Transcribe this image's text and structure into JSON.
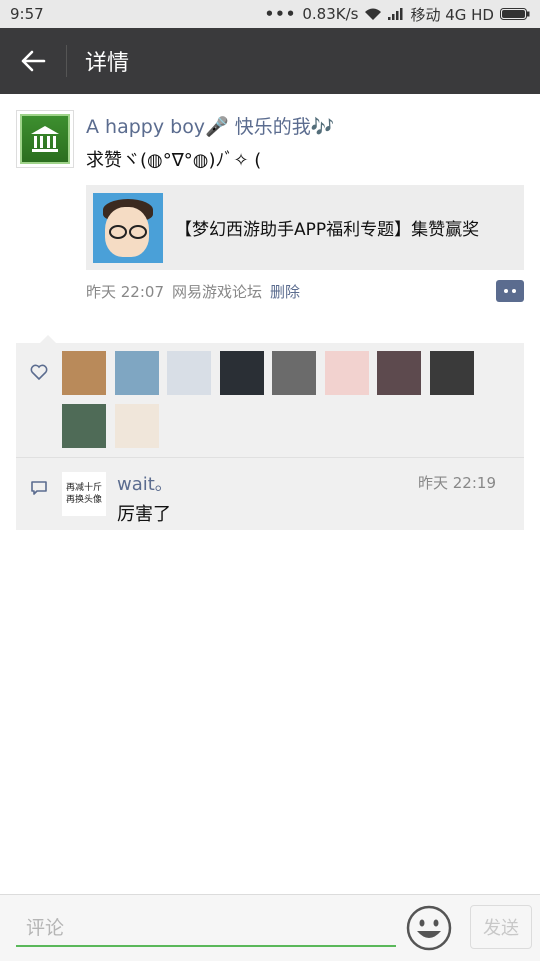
{
  "status_bar": {
    "time": "9:57",
    "dots": "•••",
    "speed": "0.83K/s",
    "carrier": "移动 4G HD"
  },
  "header": {
    "title": "详情"
  },
  "post": {
    "nickname": "A happy boy🎤 快乐的我🎶",
    "text": "求赞ヾ(◍°∇°◍)ﾉﾞ✧ (",
    "link_title": "【梦幻西游助手APP福利专题】集赞赢奖",
    "time": "昨天 22:07",
    "source": "网易游戏论坛",
    "delete_label": "删除"
  },
  "likes": {
    "avatars": [
      {
        "name": "like-avatar-1",
        "color": "#b98a5a"
      },
      {
        "name": "like-avatar-2",
        "color": "#7fa6c2"
      },
      {
        "name": "like-avatar-3",
        "color": "#d8dee6"
      },
      {
        "name": "like-avatar-4",
        "color": "#2a2f35"
      },
      {
        "name": "like-avatar-5",
        "color": "#6b6b6b"
      },
      {
        "name": "like-avatar-6",
        "color": "#f2d2cf"
      },
      {
        "name": "like-avatar-7",
        "color": "#5d4a4e"
      },
      {
        "name": "like-avatar-8",
        "color": "#3a3a3a"
      },
      {
        "name": "like-avatar-9",
        "color": "#4f6b57"
      },
      {
        "name": "like-avatar-10",
        "color": "#f0e6da"
      }
    ]
  },
  "comment": {
    "avatar_line1": "再减十斤",
    "avatar_line2": "再换头像",
    "user": "wait。",
    "time": "昨天 22:19",
    "text": "厉害了"
  },
  "bottom": {
    "placeholder": "评论",
    "send_label": "发送",
    "accent": "#5ab85a"
  }
}
